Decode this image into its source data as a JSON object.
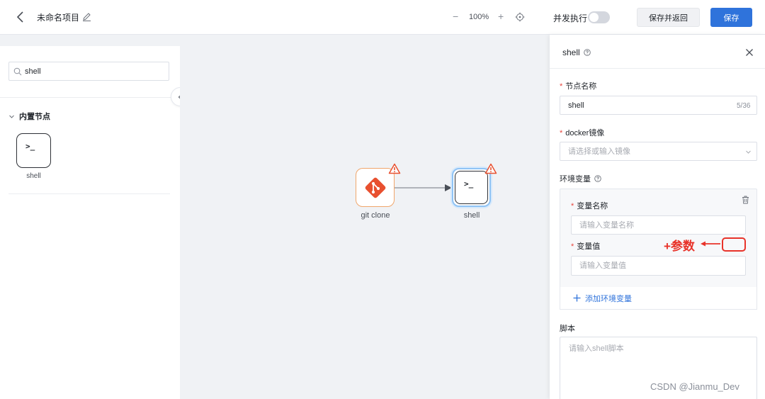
{
  "topbar": {
    "title": "未命名项目",
    "zoom_minus": "−",
    "zoom_level": "100%",
    "zoom_plus": "+",
    "concurrency_label": "并发执行",
    "concurrency_on": false,
    "save_return_label": "保存并返回",
    "save_label": "保存",
    "accent_color": "#2f73db"
  },
  "left_panel": {
    "search_value": "shell",
    "category_label": "内置节点",
    "nodes": [
      {
        "label": "shell",
        "icon": "terminal-icon",
        "glyph": ">_"
      }
    ]
  },
  "canvas": {
    "nodes": [
      {
        "label": "git clone",
        "icon": "git-icon",
        "warning": true
      },
      {
        "label": "shell",
        "icon": "terminal-icon",
        "glyph": ">_",
        "warning": true,
        "selected": true
      }
    ]
  },
  "drawer": {
    "title": "shell",
    "node_name_label": "节点名称",
    "node_name_value": "shell",
    "node_name_counter": "5/36",
    "docker_label": "docker镜像",
    "docker_placeholder": "请选择或输入镜像",
    "env_label": "环境变量",
    "env_name_label": "变量名称",
    "env_name_placeholder": "请输入变量名称",
    "env_value_label": "变量值",
    "env_value_placeholder": "请输入变量值",
    "add_env_label": "添加环境变量",
    "script_label": "脚本",
    "script_placeholder": "请输入shell脚本"
  },
  "annotation": {
    "text": "+参数",
    "color": "#e8332a"
  },
  "watermark": "CSDN @Jianmu_Dev"
}
